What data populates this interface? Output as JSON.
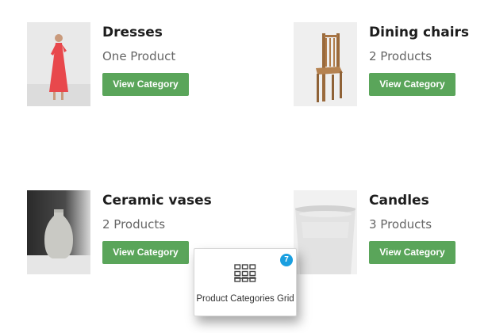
{
  "categories": [
    {
      "title": "Dresses",
      "count": "One Product",
      "button": "View Category",
      "image": "woman-in-red-dress"
    },
    {
      "title": "Dining chairs",
      "count": "2 Products",
      "button": "View Category",
      "image": "wooden-chair"
    },
    {
      "title": "Ceramic vases",
      "count": "2 Products",
      "button": "View Category",
      "image": "ceramic-vase"
    },
    {
      "title": "Candles",
      "count": "3 Products",
      "button": "View Category",
      "image": "candle-glass"
    }
  ],
  "widget": {
    "label": "Product Categories Grid",
    "badge": "7",
    "icon": "grid-icon"
  },
  "colors": {
    "button": "#5aa55a",
    "badge": "#1a9fe0"
  }
}
